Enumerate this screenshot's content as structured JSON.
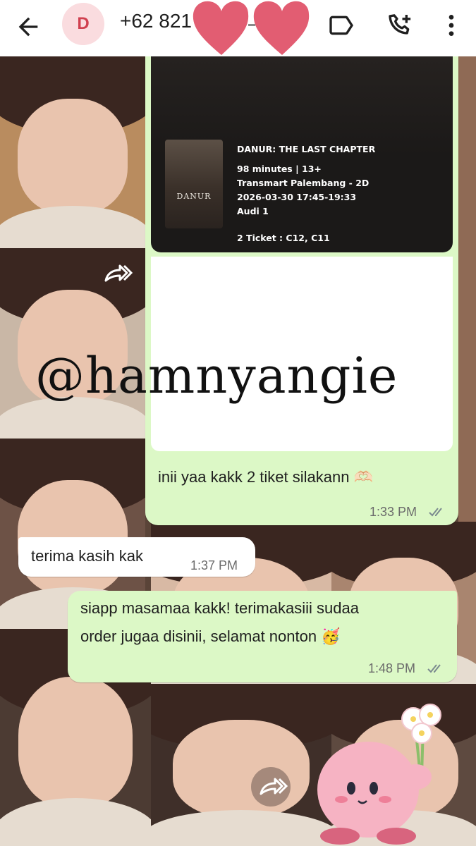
{
  "header": {
    "avatar_letter": "D",
    "contact_number": "+62 821",
    "icons": [
      "back-arrow-icon",
      "label-icon",
      "add-call-icon",
      "more-vert-icon"
    ]
  },
  "ticket": {
    "movie_title": "DANUR: THE LAST CHAPTER",
    "duration_rating": "98 minutes | 13+",
    "cinema": "Transmart Palembang - 2D",
    "schedule": "2026-03-30 17:45-19:33",
    "studio": "Audi 1",
    "seats": "2 Ticket : C12, C11",
    "poster_title": "DANUR"
  },
  "watermark": "@hamnyangie",
  "messages": [
    {
      "direction": "out",
      "text": "inii yaa kakk 2 tiket silakann 🫶🏻",
      "time": "1:33 PM",
      "status": "read"
    },
    {
      "direction": "in",
      "text": "terima kasih kak",
      "time": "1:37 PM"
    },
    {
      "direction": "out",
      "text_line1": "siapp masamaa kakk! terimakasiii sudaa",
      "text_line2": "order jugaa disinii, selamat nonton 🥳",
      "time": "1:48 PM",
      "status": "read"
    }
  ],
  "colors": {
    "outgoing_bubble": "#dcf8c6",
    "incoming_bubble": "#ffffff",
    "avatar_bg": "#fadcdf",
    "avatar_text": "#d0404f",
    "heart": "#e25d72"
  }
}
